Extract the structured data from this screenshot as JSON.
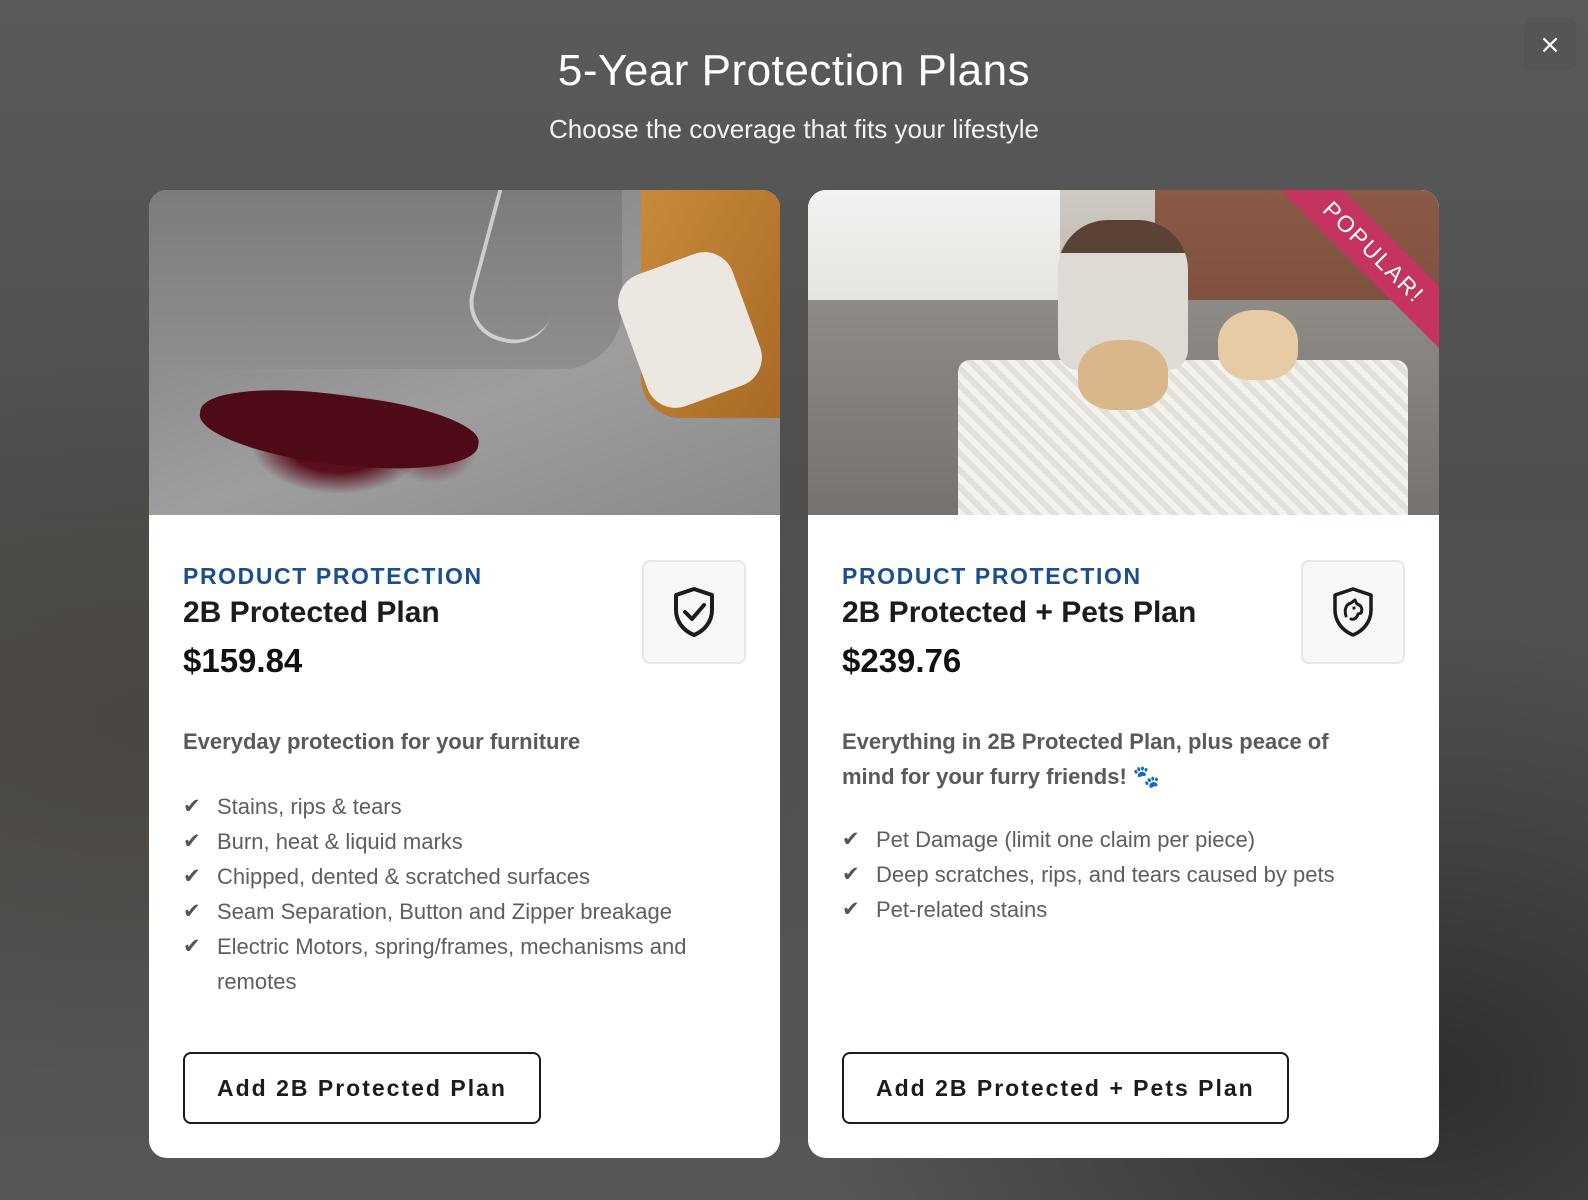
{
  "modal": {
    "title": "5-Year Protection Plans",
    "subtitle": "Choose the coverage that fits your lifestyle",
    "close_label": "×"
  },
  "plans": [
    {
      "eyebrow": "PRODUCT PROTECTION",
      "name": "2B Protected Plan",
      "price": "$159.84",
      "description": "Everyday protection for your furniture",
      "features": [
        "Stains, rips & tears",
        "Burn, heat & liquid marks",
        "Chipped, dented & scratched surfaces",
        "Seam Separation, Button and Zipper breakage",
        "Electric Motors, spring/frames, mechanisms and remotes"
      ],
      "cta": "Add 2B Protected Plan",
      "icon": "shield-check-icon"
    },
    {
      "eyebrow": "PRODUCT PROTECTION",
      "name": "2B Protected + Pets Plan",
      "price": "$239.76",
      "description": "Everything in 2B Protected Plan, plus peace of mind for your furry friends! 🐾",
      "features": [
        "Pet Damage (limit one claim per piece)",
        "Deep scratches, rips, and tears caused by pets",
        "Pet-related stains"
      ],
      "cta": "Add 2B Protected + Pets Plan",
      "icon": "shield-pet-icon",
      "badge": "POPULAR!"
    }
  ],
  "check_glyph": "✔",
  "colors": {
    "eyebrow": "#1a4f8f",
    "ribbon": "#c4345f"
  }
}
